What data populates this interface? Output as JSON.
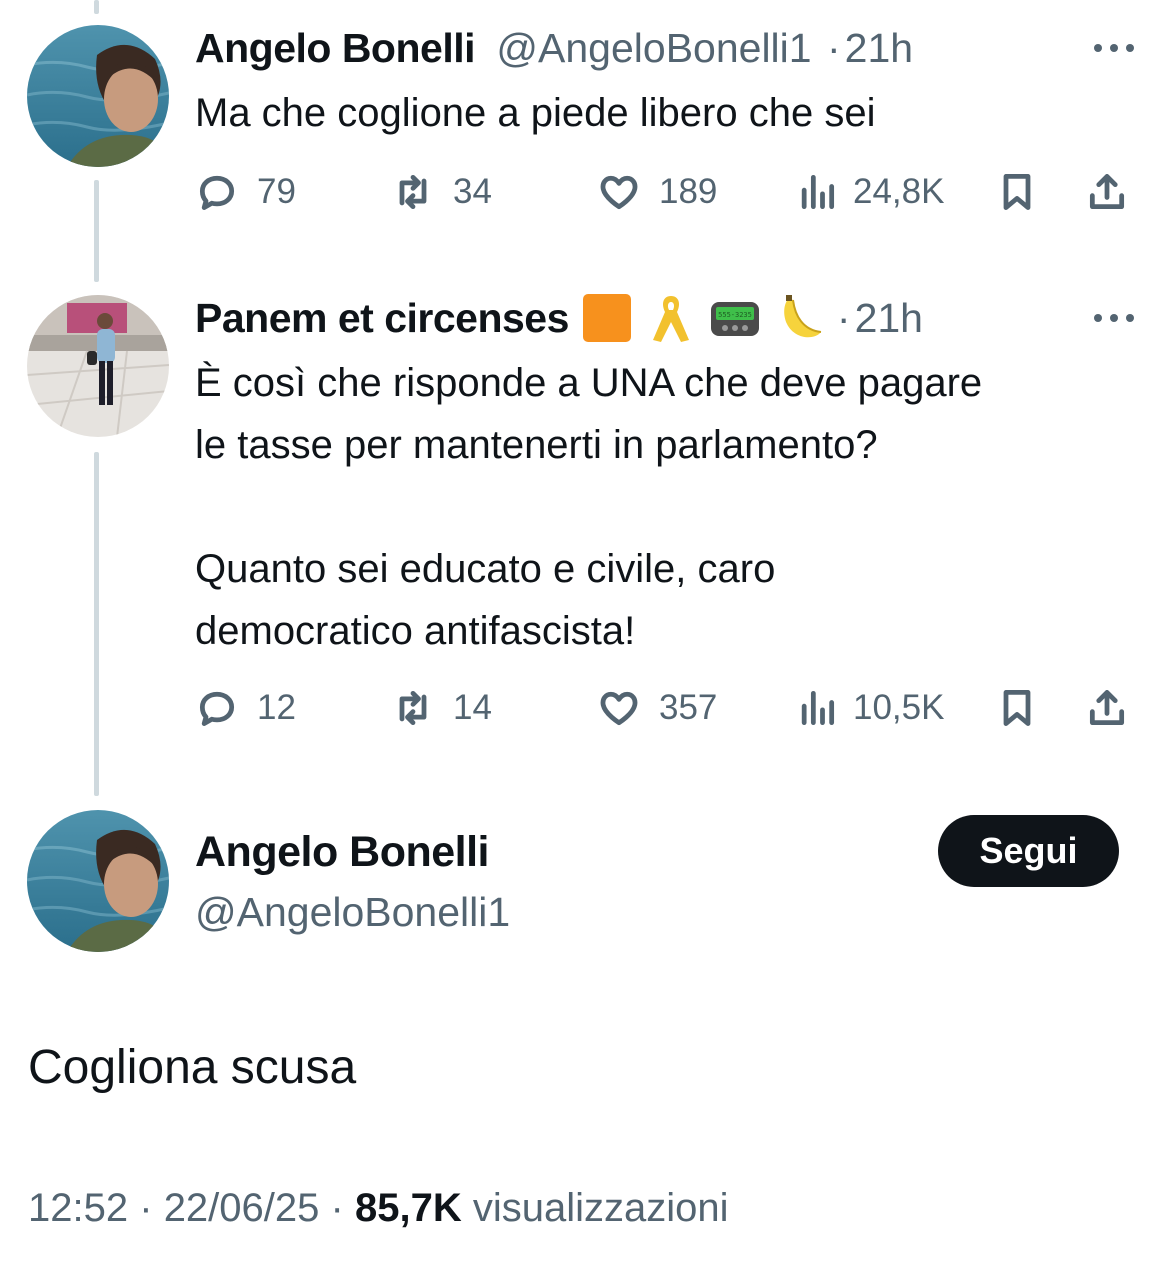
{
  "tweet1": {
    "name": "Angelo Bonelli",
    "handle": "@AngeloBonelli1",
    "time": "21h",
    "text_before": "Ma che ",
    "text_highlight": "coglione",
    "text_after": " a piede libero che sei",
    "replies": "79",
    "retweets": "34",
    "likes": "189",
    "views": "24,8K"
  },
  "tweet2": {
    "name": "Panem et circenses",
    "emoji_icons": [
      "orange-square-icon",
      "yellow-ribbon-icon",
      "pager-icon",
      "banana-icon"
    ],
    "pager_text": "555-3235",
    "time": "21h",
    "text": "È così che risponde a UNA che deve pagare\nle tasse per mantenerti in parlamento?\n\nQuanto sei educato e civile, caro\ndemocratico antifascista!",
    "replies": "12",
    "retweets": "14",
    "likes": "357",
    "views": "10,5K"
  },
  "main": {
    "name": "Angelo Bonelli",
    "handle": "@AngeloBonelli1",
    "follow_label": "Segui",
    "text_highlight": "Cogliona",
    "text_after": " scusa",
    "time": "12:52",
    "date": "22/06/25",
    "views": "85,7K",
    "views_label": "visualizzazioni"
  },
  "separator": "·",
  "colors": {
    "highlight": "#fbf74a",
    "secondary": "#536471",
    "primary": "#0f1419",
    "thread": "#cfd9de"
  }
}
